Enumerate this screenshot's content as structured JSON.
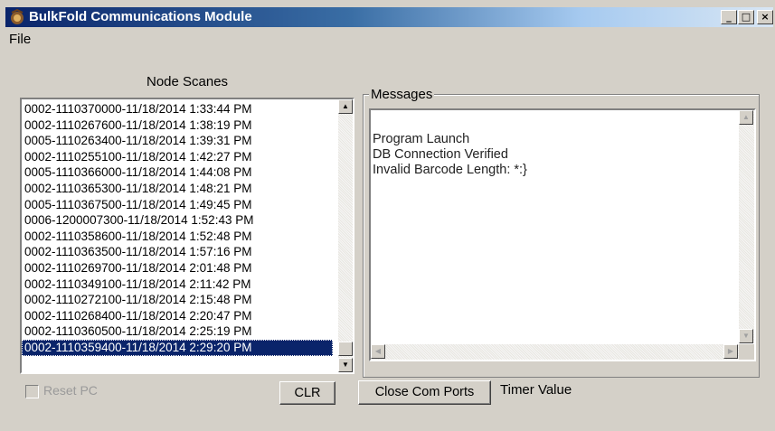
{
  "window": {
    "title": "BulkFold Communications Module",
    "controls": {
      "minimize": "_",
      "maximize": "□",
      "close": "×"
    }
  },
  "menu": {
    "file": "File"
  },
  "node_scanes": {
    "label": "Node Scanes",
    "items": [
      "0002-1110370000-11/18/2014 1:33:44 PM",
      "0002-1110267600-11/18/2014 1:38:19 PM",
      "0005-1110263400-11/18/2014 1:39:31 PM",
      "0002-1110255100-11/18/2014 1:42:27 PM",
      "0005-1110366000-11/18/2014 1:44:08 PM",
      "0002-1110365300-11/18/2014 1:48:21 PM",
      "0005-1110367500-11/18/2014 1:49:45 PM",
      "0006-1200007300-11/18/2014 1:52:43 PM",
      "0002-1110358600-11/18/2014 1:52:48 PM",
      "0002-1110363500-11/18/2014 1:57:16 PM",
      "0002-1110269700-11/18/2014 2:01:48 PM",
      "0002-1110349100-11/18/2014 2:11:42 PM",
      "0002-1110272100-11/18/2014 2:15:48 PM",
      "0002-1110268400-11/18/2014 2:20:47 PM",
      "0002-1110360500-11/18/2014 2:25:19 PM",
      "0002-1110359400-11/18/2014 2:29:20 PM"
    ],
    "selected_index": 15
  },
  "messages": {
    "label": "Messages",
    "lines": [
      "Program Launch",
      "DB Connection Verified",
      "Invalid Barcode Length: *:}"
    ]
  },
  "controls": {
    "reset_pc": "Reset PC",
    "reset_pc_checked": false,
    "clr": "CLR",
    "close_com_ports": "Close Com Ports",
    "timer_value": "Timer Value"
  },
  "icons": {
    "app": "app-icon",
    "scroll_up": "arrow-up-icon",
    "scroll_down": "arrow-down-icon",
    "scroll_left": "arrow-left-icon",
    "scroll_right": "arrow-right-icon"
  }
}
